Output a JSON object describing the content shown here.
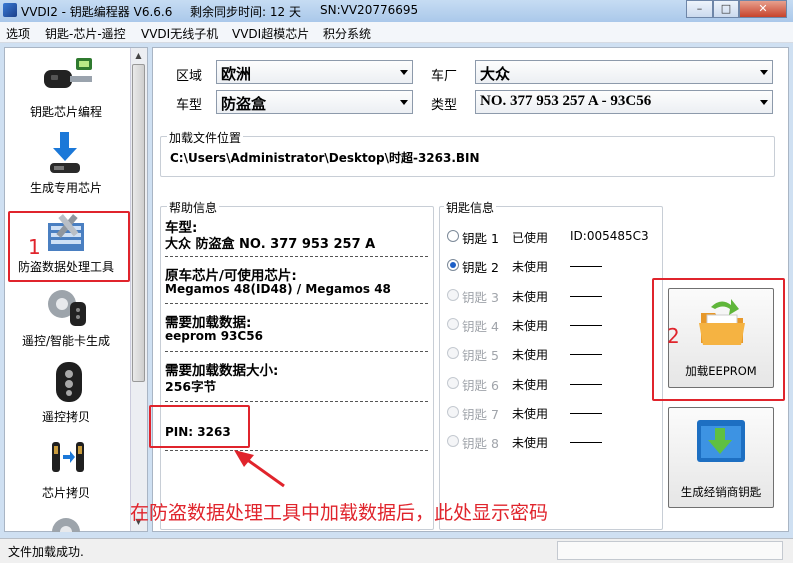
{
  "titlebar": {
    "app": "VVDI2 - 钥匙编程器 V6.6.6",
    "sync": "剩余同步时间: 12 天",
    "sn": "SN:VV20776695",
    "minimize": "–",
    "maximize": "□",
    "close": "✕"
  },
  "menu": [
    "选项",
    "钥匙-芯片-遥控",
    "VVDI无线子机",
    "VVDI超模芯片",
    "积分系统"
  ],
  "sidebar": {
    "items": [
      {
        "label": "钥匙芯片编程",
        "icon": "car-key-icon"
      },
      {
        "label": "生成专用芯片",
        "icon": "chip-download-icon"
      },
      {
        "label": "防盗数据处理工具",
        "icon": "tools-icon"
      },
      {
        "label": "遥控/智能卡生成",
        "icon": "remote-gear-icon"
      },
      {
        "label": "遥控拷贝",
        "icon": "remote-icon"
      },
      {
        "label": "芯片拷贝",
        "icon": "chip-copy-icon"
      }
    ],
    "annotation_number": "1"
  },
  "form": {
    "region_label": "区域",
    "region_value": "欧洲",
    "maker_label": "车厂",
    "maker_value": "大众",
    "model_label": "车型",
    "model_value": "防盗盒",
    "type_label": "类型",
    "type_value": "NO. 377 953 257 A - 93C56"
  },
  "load_location": {
    "title": "加载文件位置",
    "path": "C:\\Users\\Administrator\\Desktop\\时超-3263.BIN"
  },
  "help": {
    "title": "帮助信息",
    "model_heading": "车型:",
    "model_text": "大众 防盗盒 NO. 377 953 257 A",
    "chip_heading": "原车芯片/可使用芯片:",
    "chip_text": "Megamos 48(ID48) / Megamos 48",
    "data_heading": "需要加载数据:",
    "data_text": "eeprom 93C56",
    "size_heading": "需要加载数据大小:",
    "size_text": "256字节",
    "pin": "PIN: 3263"
  },
  "key_info": {
    "title": "钥匙信息",
    "keys": [
      {
        "label": "钥匙 1",
        "status": "已使用",
        "id": "ID:005485C3",
        "selected": false,
        "enabled": true
      },
      {
        "label": "钥匙 2",
        "status": "未使用",
        "id": "",
        "selected": true,
        "enabled": true
      },
      {
        "label": "钥匙 3",
        "status": "未使用",
        "id": "",
        "selected": false,
        "enabled": false
      },
      {
        "label": "钥匙 4",
        "status": "未使用",
        "id": "",
        "selected": false,
        "enabled": false
      },
      {
        "label": "钥匙 5",
        "status": "未使用",
        "id": "",
        "selected": false,
        "enabled": false
      },
      {
        "label": "钥匙 6",
        "status": "未使用",
        "id": "",
        "selected": false,
        "enabled": false
      },
      {
        "label": "钥匙 7",
        "status": "未使用",
        "id": "",
        "selected": false,
        "enabled": false
      },
      {
        "label": "钥匙 8",
        "status": "未使用",
        "id": "",
        "selected": false,
        "enabled": false
      }
    ]
  },
  "buttons": {
    "load_eeprom": "加载EEPROM",
    "generate_dealer_key": "生成经销商钥匙",
    "annotation_number": "2"
  },
  "annotation_caption": "在防盗数据处理工具中加载数据后，此处显示密码",
  "status": "文件加载成功.",
  "colors": {
    "accent_red": "#e0242c",
    "title_bar": "#b9d3ee",
    "radio_selected": "#1d5fc7"
  }
}
